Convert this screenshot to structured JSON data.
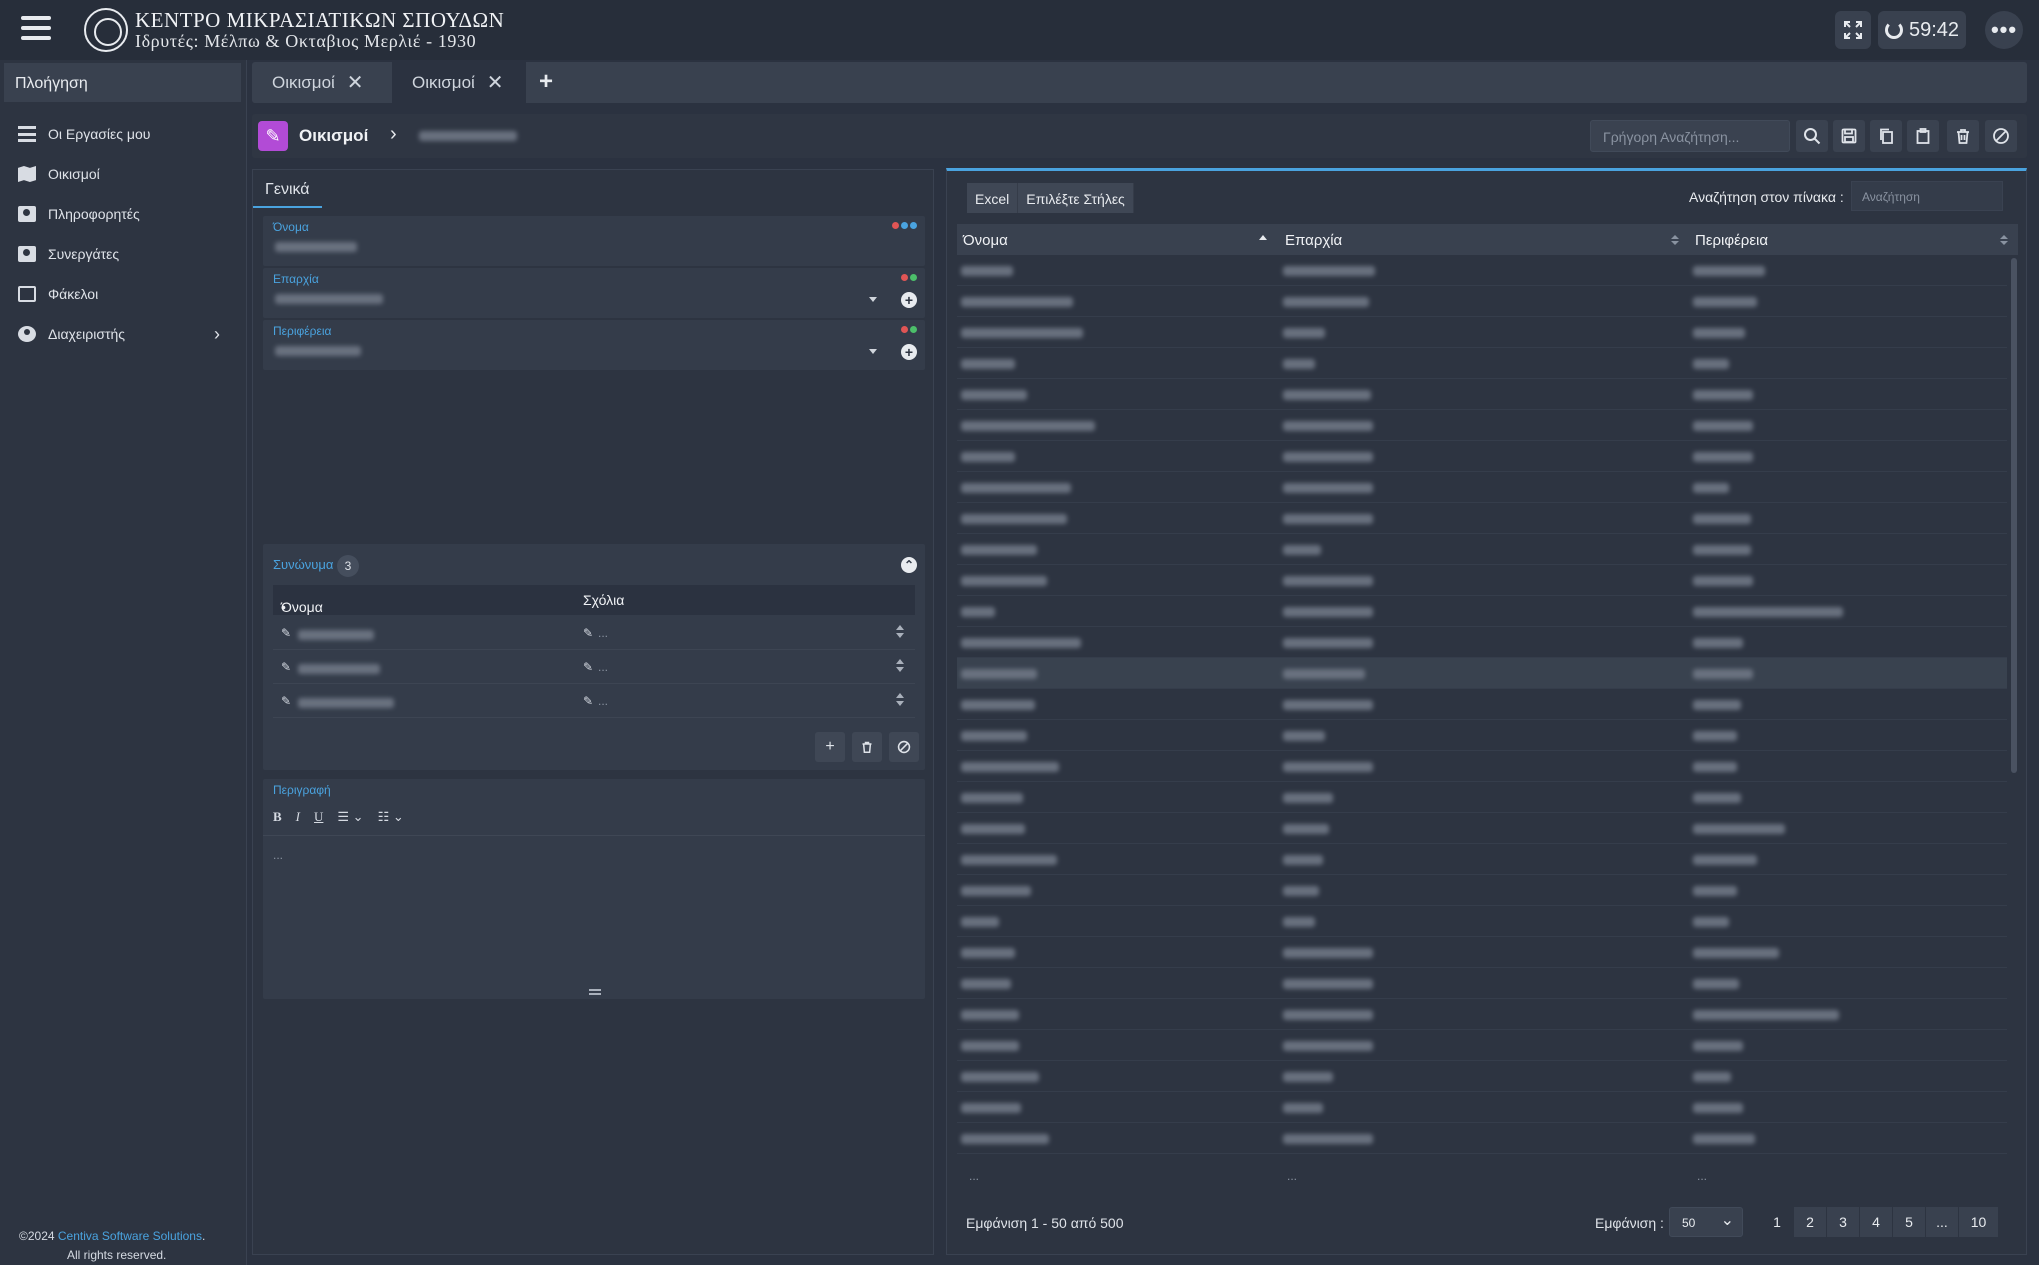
{
  "header": {
    "title": "ΚΕΝΤΡΟ ΜΙΚΡΑΣΙΑΤΙΚΩΝ ΣΠΟΥΔΩΝ",
    "subtitle": "Ιδρυτές: Μέλπω & Οκταβιος Μερλιέ - 1930",
    "timer": "59:42",
    "more_label": "•••"
  },
  "sidebar": {
    "heading": "Πλοήγηση",
    "items": [
      {
        "label": "Οι Εργασίες μου",
        "icon": "tasks-icon"
      },
      {
        "label": "Οικισμοί",
        "icon": "map-icon"
      },
      {
        "label": "Πληροφορητές",
        "icon": "contact-icon"
      },
      {
        "label": "Συνεργάτες",
        "icon": "contact-icon"
      },
      {
        "label": "Φάκελοι",
        "icon": "folder-icon"
      },
      {
        "label": "Διαχειριστής",
        "icon": "admin-icon"
      }
    ],
    "footer_year": "©2024",
    "footer_company": "Centiva Software Solutions",
    "footer_dot": ".",
    "footer_rights": "All rights reserved."
  },
  "tabs": [
    {
      "label": "Οικισμοί",
      "close": "✕"
    },
    {
      "label": "Οικισμοί",
      "close": "✕"
    }
  ],
  "tab_add": "+",
  "breadcrumb": {
    "title": "Οικισμοί",
    "chevron": "›",
    "quick_search_placeholder": "Γρήγορη Αναζήτηση..."
  },
  "form": {
    "tab_label": "Γενικά",
    "fields": [
      {
        "label": "Όνομα",
        "dots": [
          "#e05555",
          "#4aa3df",
          "#4aa3df"
        ]
      },
      {
        "label": "Επαρχία",
        "dots": [
          "#e05555",
          "#4cbf6a"
        ]
      },
      {
        "label": "Περιφέρεια",
        "dots": [
          "#e05555",
          "#4cbf6a"
        ]
      }
    ],
    "synonyms": {
      "label": "Συνώνυμα",
      "count": "3",
      "col_name": "Όνομα",
      "col_comments": "Σχόλια",
      "placeholder": "..."
    },
    "description": {
      "label": "Περιγραφή",
      "toolbar": [
        "B",
        "I",
        "U"
      ],
      "placeholder": "..."
    }
  },
  "table": {
    "excel_label": "Excel",
    "columns_label": "Επιλέξτε Στήλες",
    "search_label": "Αναζήτηση στον πίνακα :",
    "search_placeholder": "Αναζήτηση",
    "headers": [
      "Όνομα",
      "Επαρχία",
      "Περιφέρεια"
    ],
    "footer_placeholder": "...",
    "showing_text": "Εμφάνιση 1 - 50 από 500",
    "page_size_label": "Εμφάνιση :",
    "page_size": "50",
    "pages": [
      "1",
      "2",
      "3",
      "4",
      "5",
      "...",
      "10"
    ],
    "selected_row": 13
  },
  "colors": {
    "accent": "#4aa3df",
    "edit_icon_bg": "#b24bd6",
    "background": "#2b3240"
  }
}
